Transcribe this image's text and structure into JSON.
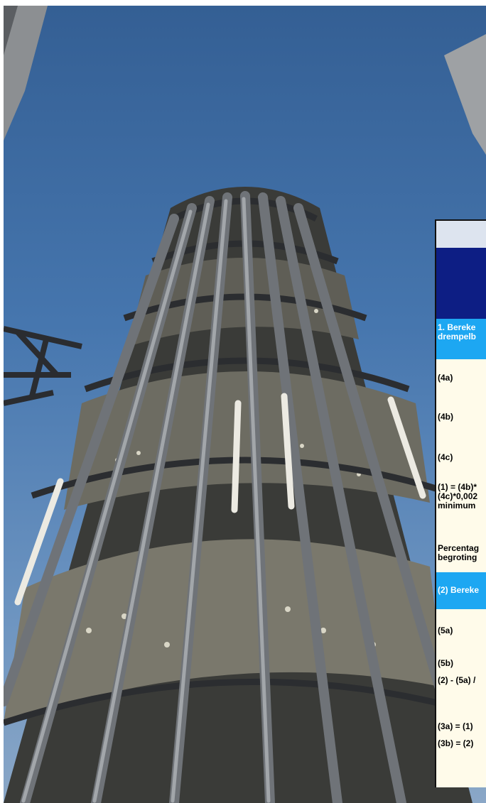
{
  "table_rows": {
    "section1_line1": "1. Bereke",
    "section1_line2": "drempelb",
    "row_4a": "(4a)",
    "row_4b": "(4b)",
    "row_4c": "(4c)",
    "row_1_line1": "(1) = (4b)*",
    "row_1_line2": "(4c)*0,002",
    "row_1_line3": "minimum",
    "row_pct_line1": "Percentag",
    "row_pct_line2": "begroting",
    "section2": "(2) Bereke",
    "row_5a": "(5a)",
    "row_5b": "(5b)",
    "row_2": "(2) - (5a) /",
    "row_3a": "(3a) = (1)",
    "row_3b": "(3b) = (2)"
  },
  "colors": {
    "header_band": "#0d1e84",
    "section_band": "#1da7f2",
    "table_bg": "#fffbea",
    "sky": "#4676ae"
  }
}
